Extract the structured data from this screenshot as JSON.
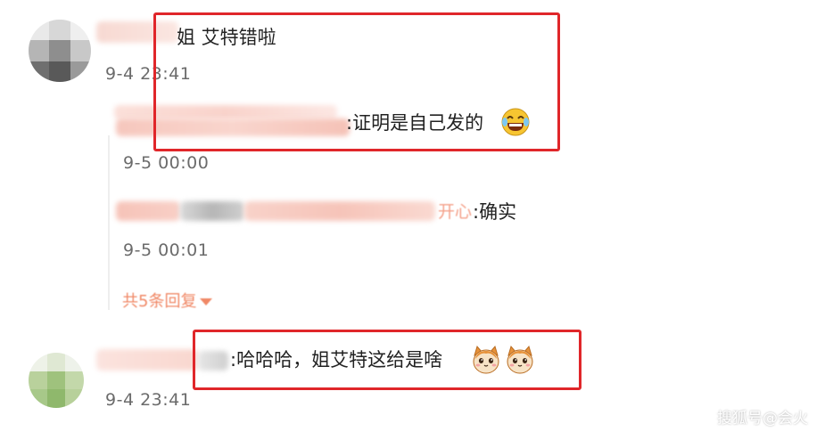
{
  "comments": [
    {
      "text": "姐 艾特错啦",
      "time": "9-4 23:41",
      "replies": [
        {
          "text": ":证明是自己发的",
          "time": "9-5 00:00"
        },
        {
          "name_tail": "开心",
          "text": ":确实",
          "time": "9-5 00:01"
        }
      ],
      "more_replies_label": "共5条回复"
    },
    {
      "text": ":哈哈哈，姐艾特这给是啥",
      "time": "9-4 23:41"
    }
  ],
  "watermark": "搜狐号@会火",
  "colors": {
    "highlight_border": "#e0262a",
    "more_replies": "#f08866",
    "timestamp": "#6b6b6b"
  },
  "icons": [
    "laughing-tears-emoji",
    "cat-face-emoji"
  ]
}
